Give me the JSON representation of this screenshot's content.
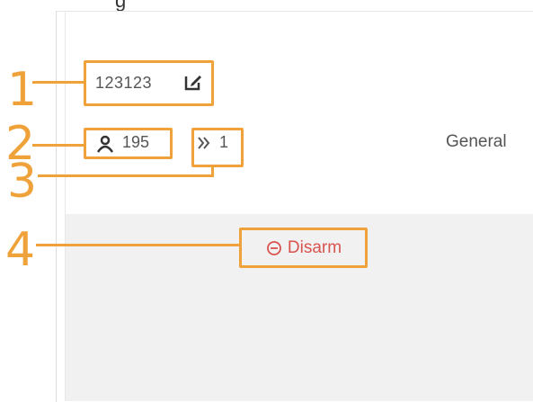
{
  "header_fragment": "g",
  "record": {
    "name": "123123",
    "user_count": "195",
    "zone_count": "1",
    "tab_label": "General"
  },
  "actions": {
    "disarm_label": "Disarm"
  },
  "callouts": [
    "1",
    "2",
    "3",
    "4"
  ],
  "colors": {
    "callout": "#f0a23a",
    "disarm": "#d9534f",
    "text": "#555555",
    "gray_area": "#f1f1f1"
  },
  "icons": {
    "edit": "edit-icon",
    "user": "user-icon",
    "zone": "chevron-right-double-icon",
    "disarm": "minus-circle-icon"
  }
}
